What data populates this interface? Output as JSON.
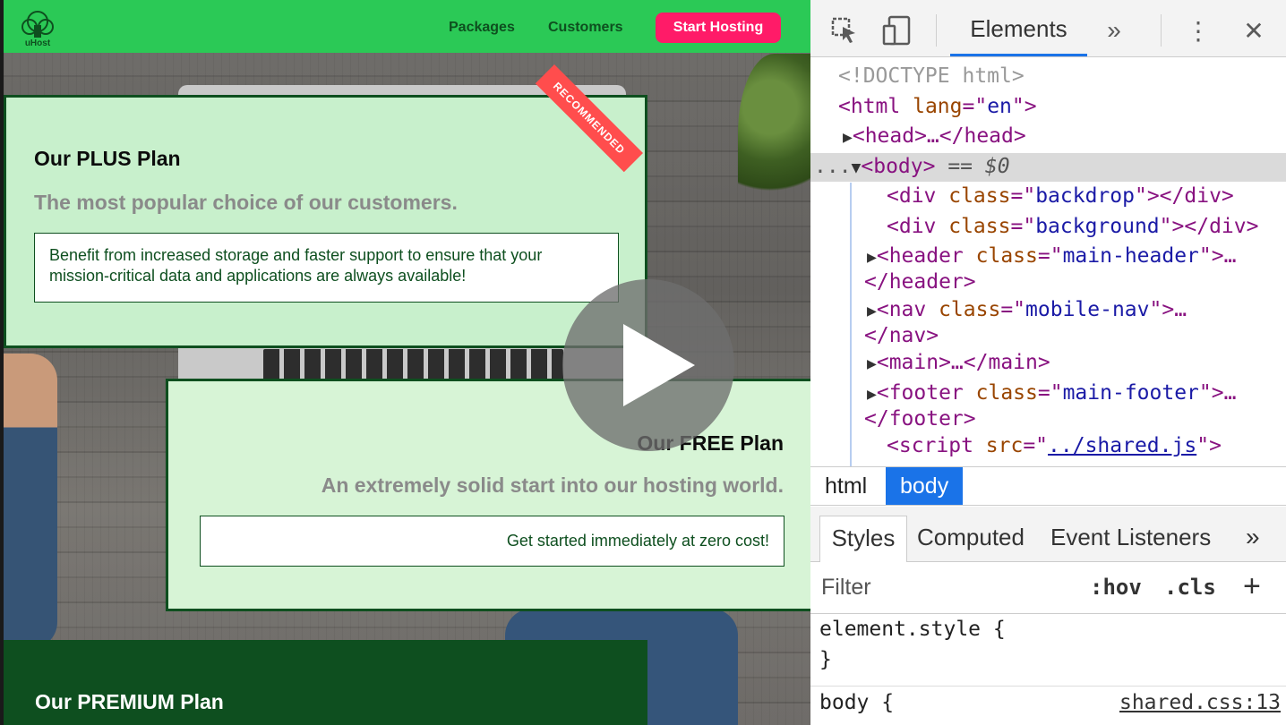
{
  "site": {
    "logo_text": "uHost",
    "nav": {
      "packages": "Packages",
      "customers": "Customers",
      "cta": "Start Hosting"
    },
    "plans": {
      "plus": {
        "title": "Our PLUS Plan",
        "subtitle": "The most popular choice of our customers.",
        "description": "Benefit from increased storage and faster support to ensure that your mission-critical data and applications are always available!",
        "badge": "RECOMMENDED"
      },
      "free": {
        "title": "Our FREE Plan",
        "subtitle": "An extremely solid start into our hosting world.",
        "description": "Get started immediately at zero cost!"
      },
      "premium": {
        "title": "Our PREMIUM Plan"
      }
    },
    "colors": {
      "header": "#2bc956",
      "cta": "#ff1b68",
      "dark_green": "#0e4f1f",
      "badge": "#ff4d4d"
    }
  },
  "devtools": {
    "toolbar": {
      "elements_tab": "Elements",
      "more_tabs": "»",
      "menu_icon": "⋮",
      "close_icon": "✕"
    },
    "dom": {
      "doctype": "<!DOCTYPE html>",
      "html_open": {
        "tag": "<html",
        "attr": " lang",
        "eq": "=\"",
        "val": "en",
        "end": "\">"
      },
      "head": "<head>…</head>",
      "body_prefix": "...",
      "body_tag": "<body>",
      "body_suffix": " == $0",
      "div_backdrop": {
        "open": "<div",
        "attr": " class",
        "val": "backdrop",
        "close": "></div>"
      },
      "div_background": {
        "open": "<div",
        "attr": " class",
        "val": "background",
        "close": "></div>"
      },
      "header": {
        "open": "<header",
        "attr": " class",
        "val": "main-header",
        "close": ">…",
        "end": "</header>"
      },
      "nav": {
        "open": "<nav",
        "attr": " class",
        "val": "mobile-nav",
        "close": ">…",
        "end": "</nav>"
      },
      "main": "<main>…</main>",
      "footer": {
        "open": "<footer",
        "attr": " class",
        "val": "main-footer",
        "close": ">…",
        "end": "</footer>"
      },
      "script": {
        "open": "<script",
        "attr": " src",
        "val": "../shared.js",
        "close": ">"
      }
    },
    "breadcrumbs": [
      "html",
      "body"
    ],
    "sub_tabs": {
      "styles": "Styles",
      "computed": "Computed",
      "events": "Event Listeners",
      "more": "»"
    },
    "filter": {
      "label": "Filter",
      "hov": ":hov",
      "cls": ".cls",
      "add": "+"
    },
    "rules": {
      "element_style_open": "element.style {",
      "element_style_close": "}",
      "body_rule": "body {",
      "body_source": "shared.css:13"
    }
  }
}
